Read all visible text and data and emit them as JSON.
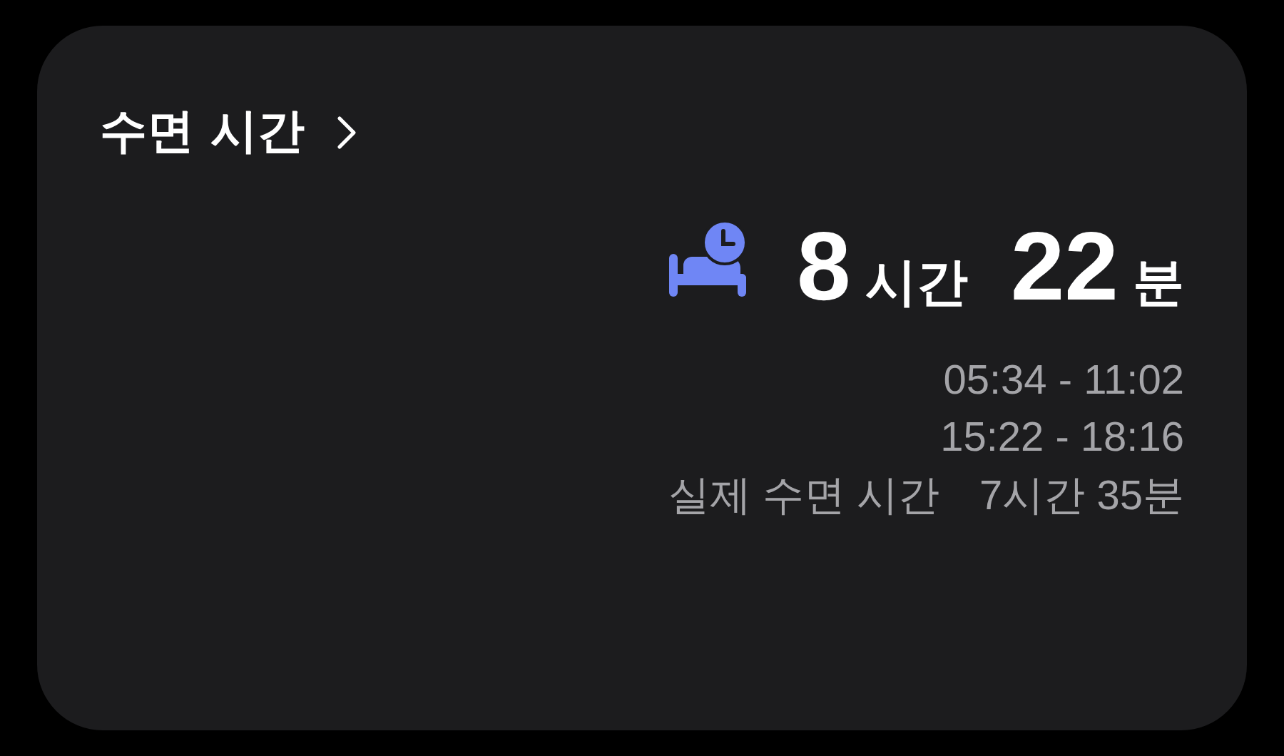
{
  "card": {
    "title": "수면 시간",
    "total": {
      "hours": "8",
      "hours_unit": "시간",
      "minutes": "22",
      "minutes_unit": "분"
    },
    "periods": [
      "05:34 - 11:02",
      "15:22 - 18:16"
    ],
    "actual": {
      "label": "실제 수면 시간",
      "value": "7시간 35분"
    }
  }
}
